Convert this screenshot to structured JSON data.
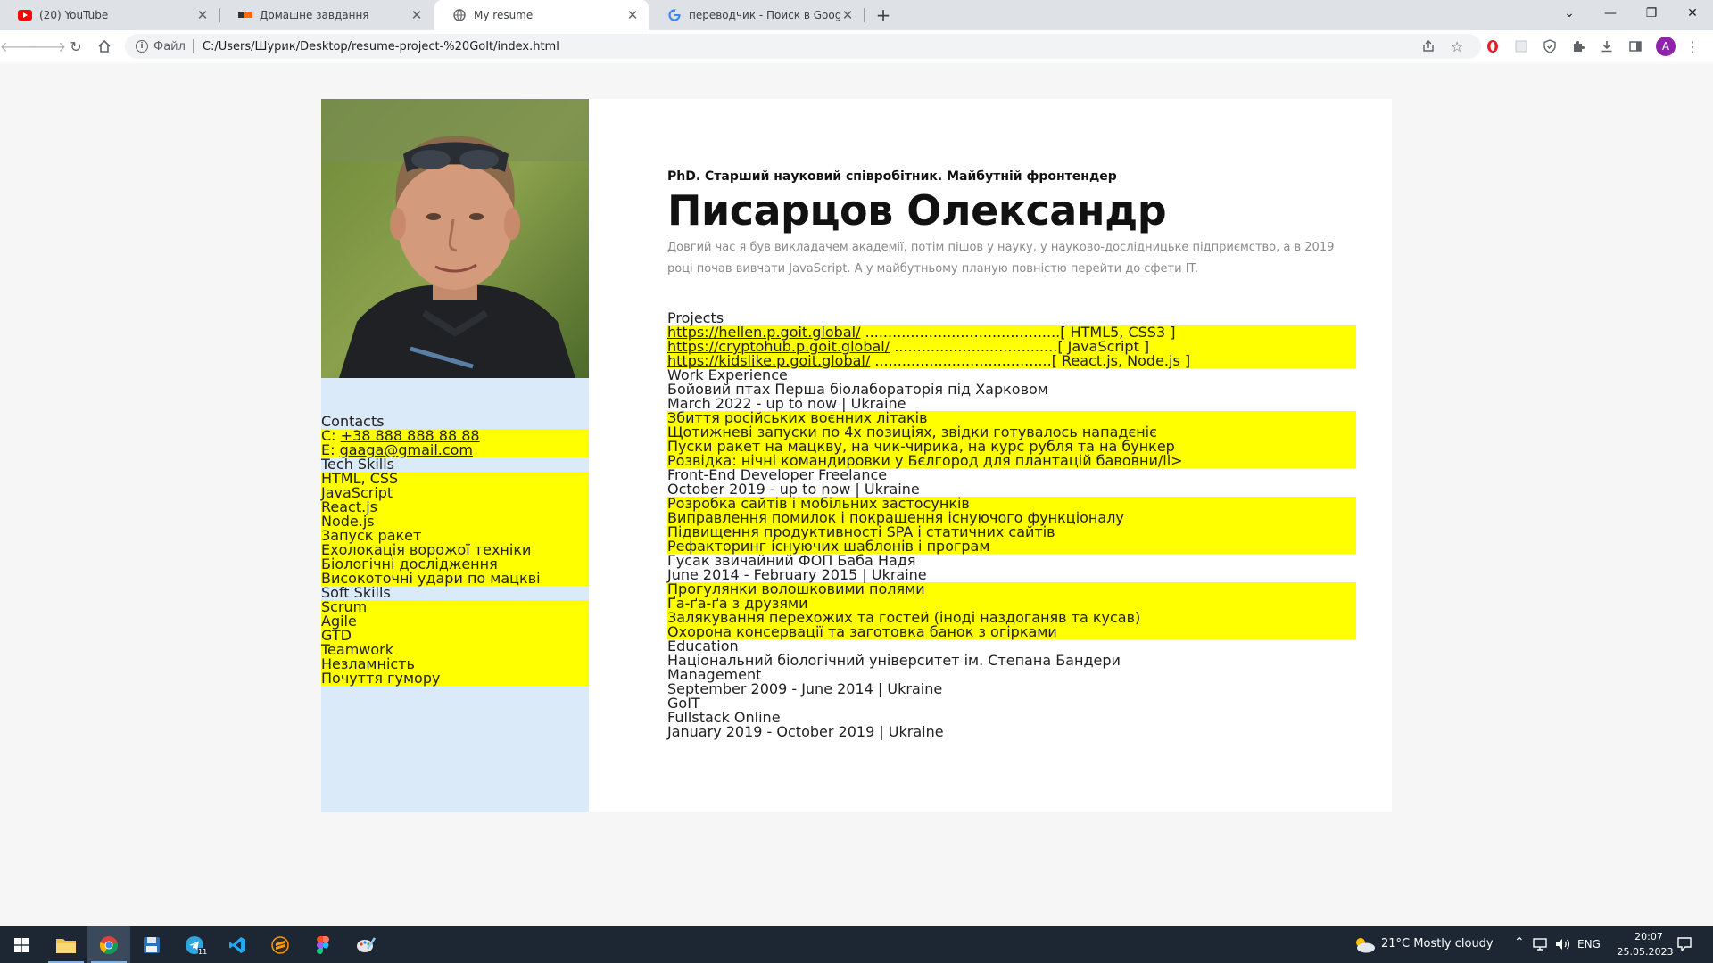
{
  "browser": {
    "tabs": [
      {
        "title": "(20) YouTube",
        "icon": "youtube-icon"
      },
      {
        "title": "Домашне завдання",
        "icon": "goit-icon"
      },
      {
        "title": "My resume",
        "icon": "globe-icon",
        "active": true
      },
      {
        "title": "переводчик - Поиск в Google",
        "icon": "google-icon"
      }
    ],
    "address": {
      "scheme_label": "Файл",
      "url": "C:/Users/Шурик/Desktop/resume-project-%20GoIt/index.html"
    },
    "profile_initial": "A"
  },
  "page": {
    "sidebar": {
      "contacts_title": "Contacts",
      "phone_prefix": "C: ",
      "phone": "+38 888 888 88 88",
      "email_prefix": "E: ",
      "email": "gaaga@gmail.com",
      "tech_title": "Tech Skills",
      "tech_skills": [
        "HTML, CSS",
        "JavaScript",
        "React.js",
        "Node.js",
        "Запуск ракет",
        "Ехолокація ворожої техніки",
        "Біологічні дослідження",
        "Високоточні удари по мацкві"
      ],
      "soft_title": "Soft Skills",
      "soft_skills": [
        "Scrum",
        "Agile",
        "GTD",
        "Teamwork",
        "Незламність",
        "Почуття гумору"
      ]
    },
    "subtitle": "PhD. Старший науковий співробітник. Майбутній фронтендер",
    "name": "Писарцов Олександр",
    "about": "Довгий час я був викладачем академії, потім пішов у науку, у науково-дослідницьке підприємство, а в 2019 році почав вивчати JavaScript. А у майбутньому планую повністю перейти до сфети IT.",
    "projects_title": "Projects",
    "projects": [
      {
        "url": "https://hellen.p.goit.global/",
        "dots": " ...........................................",
        "tech": "[ HTML5, CSS3 ]"
      },
      {
        "url": "https://cryptohub.p.goit.global/",
        "dots": " ....................................",
        "tech": "[ JavaScript ]"
      },
      {
        "url": "https://kidslike.p.goit.global/",
        "dots": " .......................................",
        "tech": "[ React.js, Node.js ]"
      }
    ],
    "work_title": "Work Experience",
    "jobs": [
      {
        "title": "Бойовий птах Перша біолабораторія під Харковом",
        "period": "March 2022 - up to now | Ukraine",
        "duties": [
          "Збиття російських воєнних літаків",
          "Щотижневі запуски по 4х позиціях, звідки готувалось нападєніє",
          "Пуски ракет на мацкву, на чик-чирика, на курс рубля та на бункер",
          "Розвідка: нічні командировки у Бєлгород для плантацій бавовни/li>"
        ]
      },
      {
        "title": "Front-End Developer Freelance",
        "period": "October 2019 - up to now | Ukraine",
        "duties": [
          "Розробка сайтів і мобільних застосунків",
          "Виправлення помилок і покращення існуючого функціоналу",
          "Підвищення продуктивності SPA і статичних сайтів",
          "Рефакторинг існуючих шаблонів і програм"
        ]
      },
      {
        "title": "Гусак звичайний ФОП Баба Надя",
        "period": "June 2014 - February 2015 | Ukraine",
        "duties": [
          "Прогулянки волошковими полями",
          "Ґа-ґа-ґа з друзями",
          "Залякування перехожих та гостей (іноді наздоганяв та кусав)",
          "Охорона консервації та заготовка банок з огірками"
        ]
      }
    ],
    "education_title": "Education",
    "education": [
      {
        "school": "Національний біологічний університет ім. Степана Бандери",
        "field": "Management",
        "period": "September 2009 - June 2014 | Ukraine"
      },
      {
        "school": "GoIT",
        "field": "Fullstack Online",
        "period": "January 2019 - October 2019 | Ukraine"
      }
    ]
  },
  "taskbar": {
    "weather": "21°C  Mostly cloudy",
    "language": "ENG",
    "time": "20:07",
    "date": "25.05.2023",
    "telegram_badge": "11"
  }
}
